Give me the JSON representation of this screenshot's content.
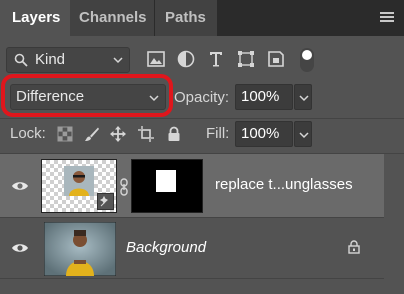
{
  "tabs": [
    {
      "label": "Layers"
    },
    {
      "label": "Channels"
    },
    {
      "label": "Paths"
    }
  ],
  "filter": {
    "kind_label": "Kind",
    "icons": [
      "image-filter-icon",
      "adjustment-filter-icon",
      "type-filter-icon",
      "shape-filter-icon",
      "smart-object-filter-icon",
      "filter-toggle"
    ]
  },
  "blend": {
    "mode": "Difference",
    "opacity_label": "Opacity:",
    "opacity_value": "100%"
  },
  "lock": {
    "label": "Lock:",
    "fill_label": "Fill:",
    "fill_value": "100%"
  },
  "layers": [
    {
      "name": "replace t...unglasses",
      "selected": true
    },
    {
      "name": "Background",
      "selected": false,
      "locked": true
    }
  ],
  "colors": {
    "accent_highlight": "#e0161c",
    "panel_bg": "#535353",
    "selected_row": "#6a6a6a"
  }
}
